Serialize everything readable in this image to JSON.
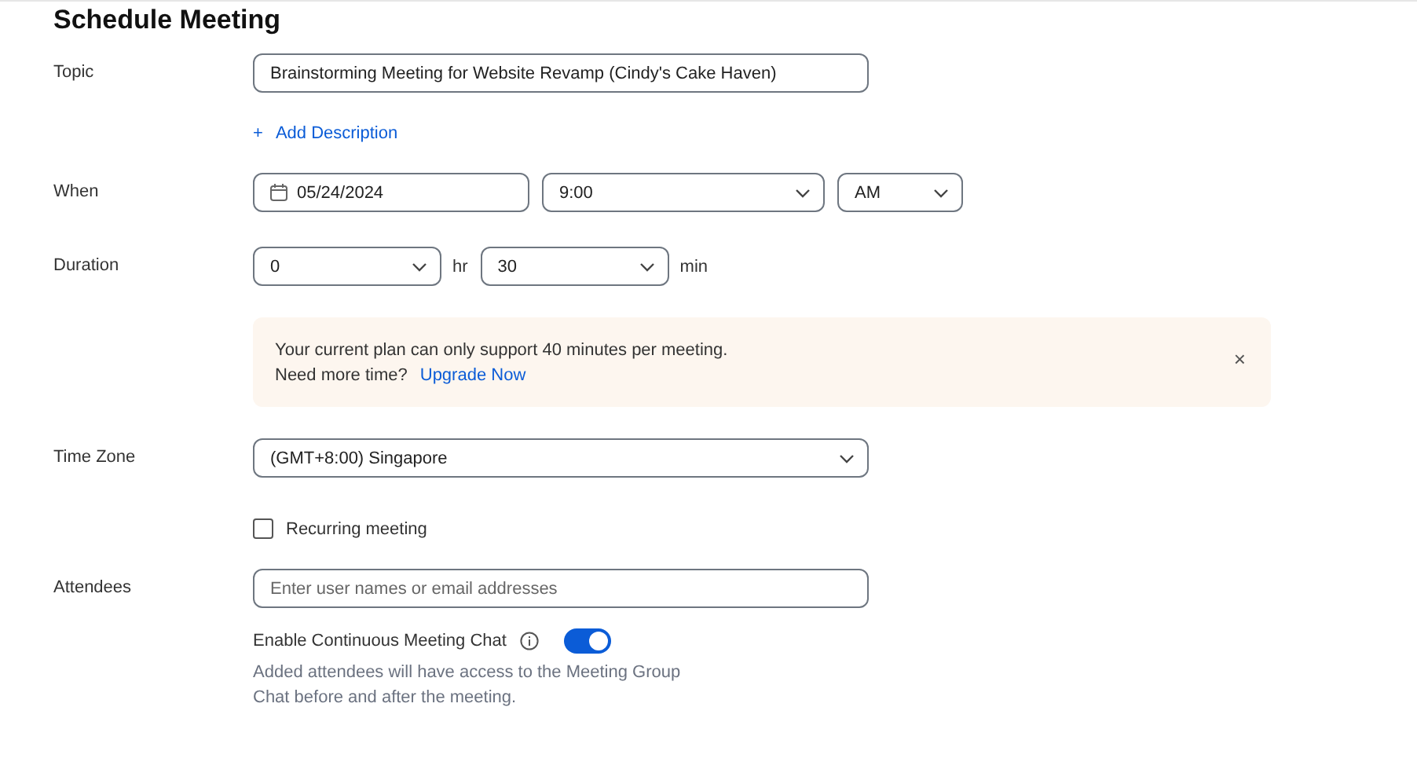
{
  "title": "Schedule Meeting",
  "topic": {
    "label": "Topic",
    "value": "Brainstorming Meeting for Website Revamp (Cindy's Cake Haven)"
  },
  "add_description": {
    "icon": "+",
    "label": "Add Description"
  },
  "when": {
    "label": "When",
    "date": "05/24/2024",
    "time": "9:00",
    "period": "AM"
  },
  "duration": {
    "label": "Duration",
    "hours": "0",
    "hours_unit": "hr",
    "minutes": "30",
    "minutes_unit": "min"
  },
  "notice": {
    "message": "Your current plan can only support 40 minutes per meeting.",
    "prompt": "Need more time?",
    "link": "Upgrade Now",
    "close": "×"
  },
  "time_zone": {
    "label": "Time Zone",
    "value": "(GMT+8:00) Singapore"
  },
  "recurring": {
    "label": "Recurring meeting",
    "checked": false
  },
  "attendees": {
    "label": "Attendees",
    "placeholder": "Enter user names or email addresses"
  },
  "continuous_chat": {
    "label": "Enable Continuous Meeting Chat",
    "on": true,
    "note": "Added attendees will have access to the Meeting Group Chat before and after the meeting."
  }
}
